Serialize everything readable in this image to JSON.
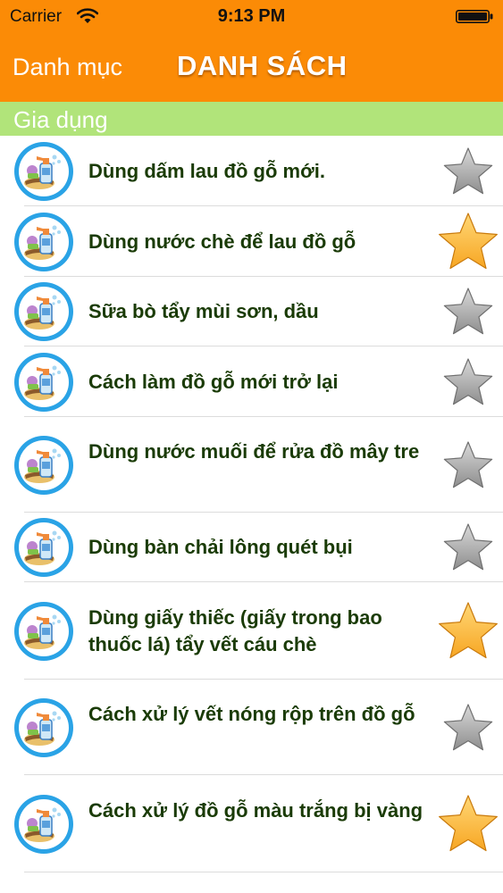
{
  "status_bar": {
    "carrier": "Carrier",
    "time": "9:13 PM"
  },
  "nav_bar": {
    "back_label": "Danh mục",
    "title": "DANH SÁCH"
  },
  "section": {
    "title": "Gia dụng"
  },
  "items": [
    {
      "title": "Dùng dấm lau đồ gỗ mới.",
      "favorite": false,
      "icon": "cleaning-supplies-icon"
    },
    {
      "title": "Dùng nước chè để lau đồ gỗ",
      "favorite": true,
      "icon": "cleaning-supplies-icon"
    },
    {
      "title": "Sữa bò tẩy mùi sơn, dầu",
      "favorite": false,
      "icon": "cleaning-supplies-icon"
    },
    {
      "title": "Cách làm đồ gỗ mới trở lại",
      "favorite": false,
      "icon": "cleaning-supplies-icon"
    },
    {
      "title": "Dùng nước muối để rửa đồ mây tre",
      "favorite": false,
      "icon": "cleaning-supplies-icon"
    },
    {
      "title": "Dùng bàn chải lông quét bụi",
      "favorite": false,
      "icon": "cleaning-supplies-icon"
    },
    {
      "title": "Dùng giấy thiếc (giấy trong bao thuốc lá) tẩy vết cáu chè",
      "favorite": true,
      "icon": "cleaning-supplies-icon"
    },
    {
      "title": "Cách xử lý vết nóng rộp trên đồ gỗ",
      "favorite": false,
      "icon": "cleaning-supplies-icon"
    },
    {
      "title": "Cách xử lý đồ gỗ màu trắng bị vàng",
      "favorite": true,
      "icon": "cleaning-supplies-icon"
    }
  ],
  "colors": {
    "nav_bar": "#fb8b06",
    "section_header": "#b1e47a",
    "item_text": "#1a3b06",
    "star_favorite": "#f7a623",
    "star_default": "#9a9a9a",
    "icon_circle": "#2aa3e6"
  }
}
